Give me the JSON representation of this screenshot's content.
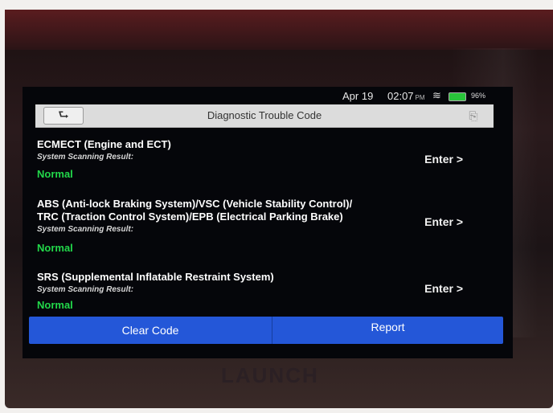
{
  "status_bar": {
    "date": "Apr 19",
    "time": "02:07",
    "ampm": "PM",
    "battery": "96%",
    "wifi_icon": "wifi-icon",
    "battery_icon": "battery-icon"
  },
  "header": {
    "title": "Diagnostic Trouble Code",
    "back_icon": "back-arrow-icon",
    "exit_icon": "exit-icon"
  },
  "systems": [
    {
      "name_lines": [
        "ECMECT (Engine and ECT)"
      ],
      "scan_label": "System Scanning Result:",
      "result": "Normal",
      "enter_label": "Enter >"
    },
    {
      "name_lines": [
        "ABS (Anti-lock Braking System)/VSC (Vehicle Stability Control)/",
        "TRC (Traction Control System)/EPB (Electrical Parking Brake)"
      ],
      "scan_label": "System Scanning Result:",
      "result": "Normal",
      "enter_label": "Enter >"
    },
    {
      "name_lines": [
        "SRS (Supplemental Inflatable Restraint System)"
      ],
      "scan_label": "System Scanning Result:",
      "result": "Normal",
      "enter_label": "Enter >"
    }
  ],
  "footer": {
    "clear_label": "Clear Code",
    "report_label": "Report"
  },
  "device": {
    "brand": "LAUNCH"
  },
  "colors": {
    "result_green": "#22d84a",
    "button_blue": "#2457d8",
    "screen_bg": "#05060a"
  }
}
